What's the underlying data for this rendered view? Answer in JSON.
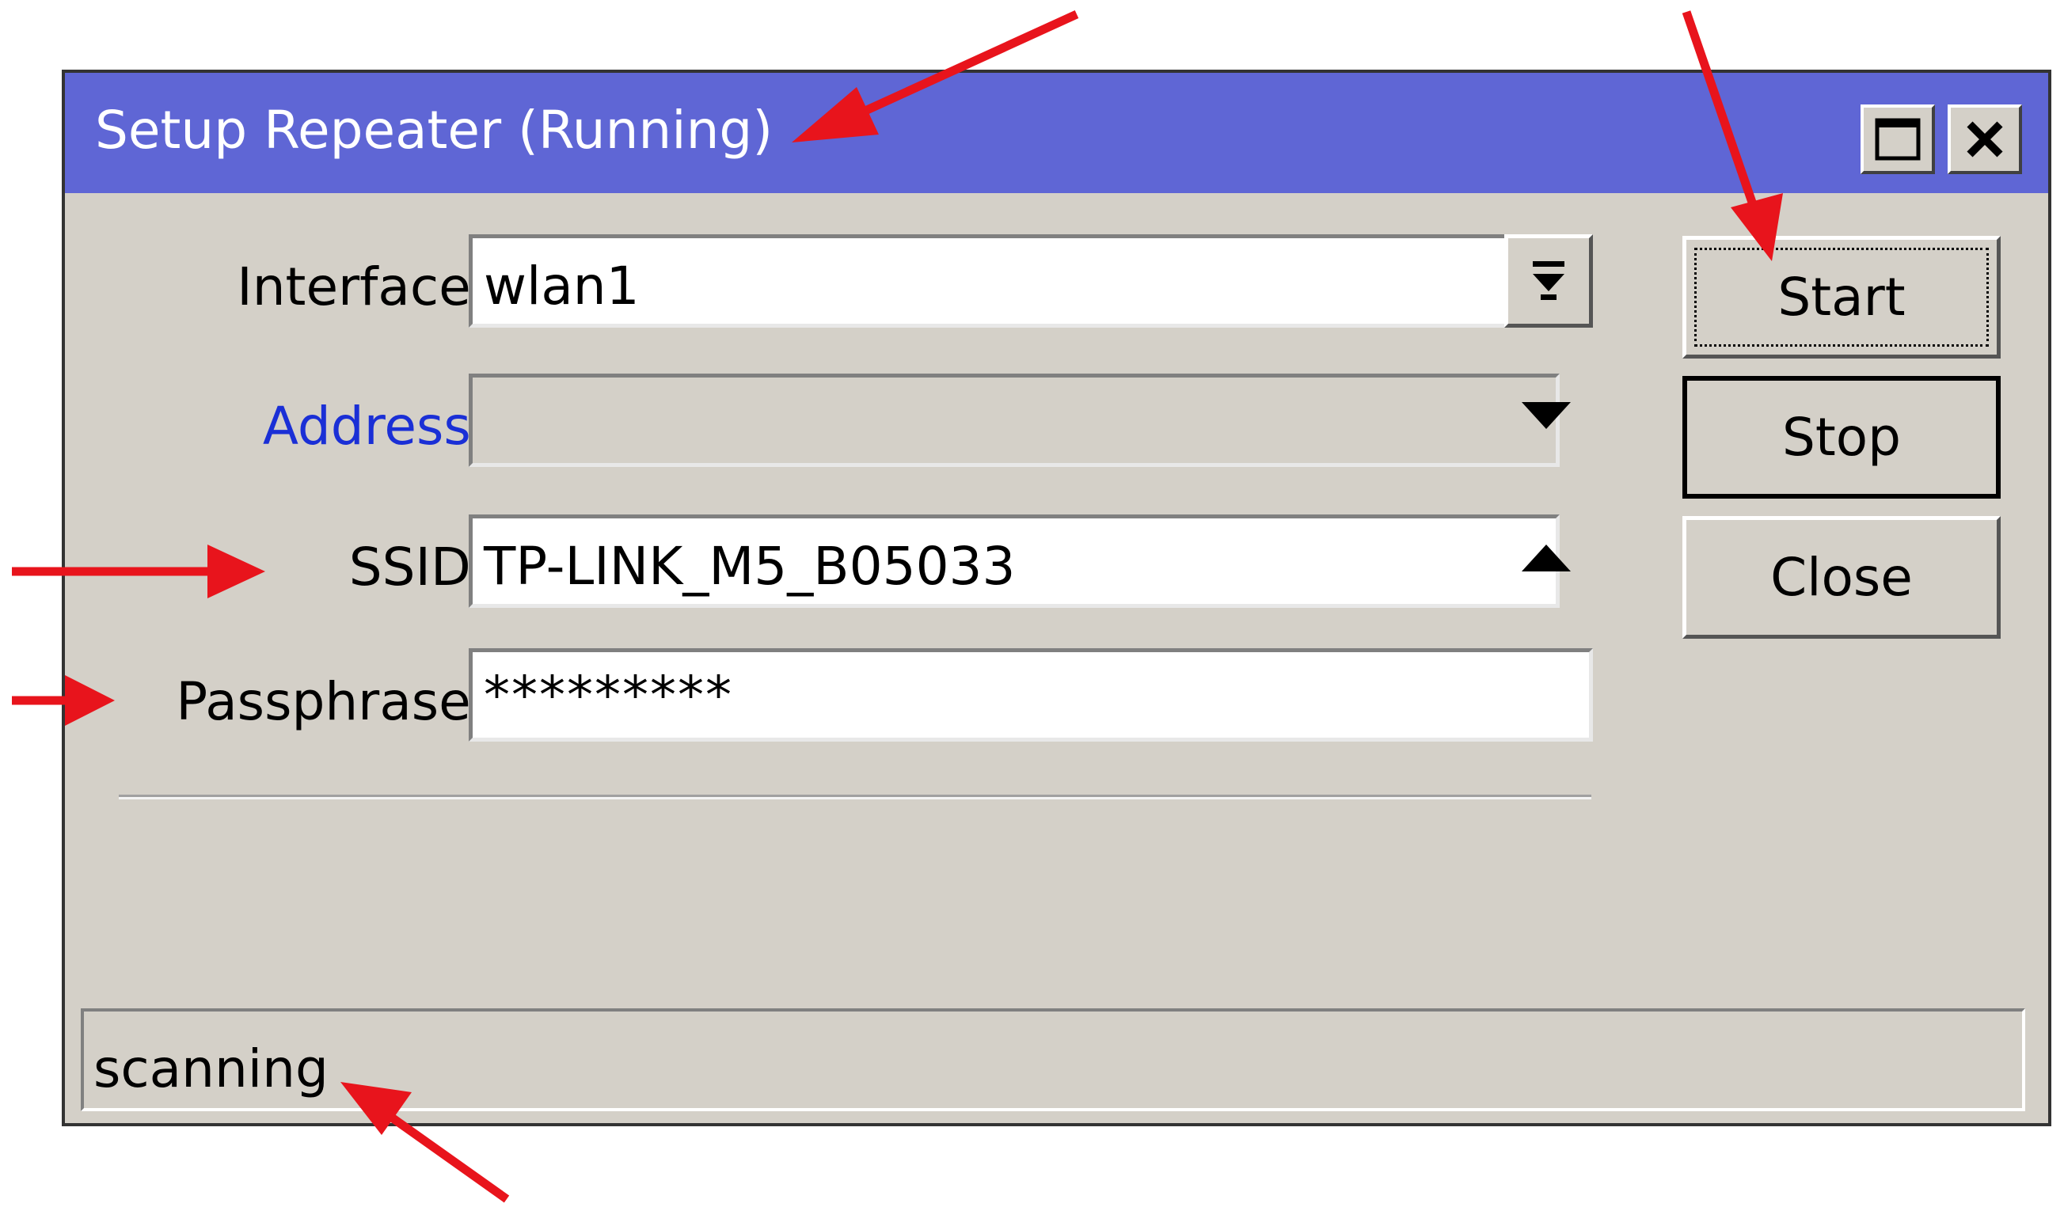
{
  "window": {
    "title": "Setup Repeater (Running)"
  },
  "form": {
    "interface_label": "Interface:",
    "interface_value": "wlan1",
    "address_label": "Address:",
    "address_value": "",
    "ssid_label": "SSID:",
    "ssid_value": "TP-LINK_M5_B05033",
    "passphrase_label": "Passphrase:",
    "passphrase_value": "*********"
  },
  "buttons": {
    "start": "Start",
    "stop": "Stop",
    "close": "Close"
  },
  "status": {
    "text": "scanning"
  },
  "icons": {
    "maximize": "maximize-icon",
    "close": "close-icon",
    "interface_dropdown": "dropdown-bar-icon",
    "expand": "triangle-down-icon",
    "collapse": "triangle-up-icon"
  },
  "colors": {
    "titlebar": "#5f66d5",
    "window_bg": "#d4d0c8",
    "address_label": "#1a2fd6",
    "annotation_arrow": "#e8141c"
  }
}
